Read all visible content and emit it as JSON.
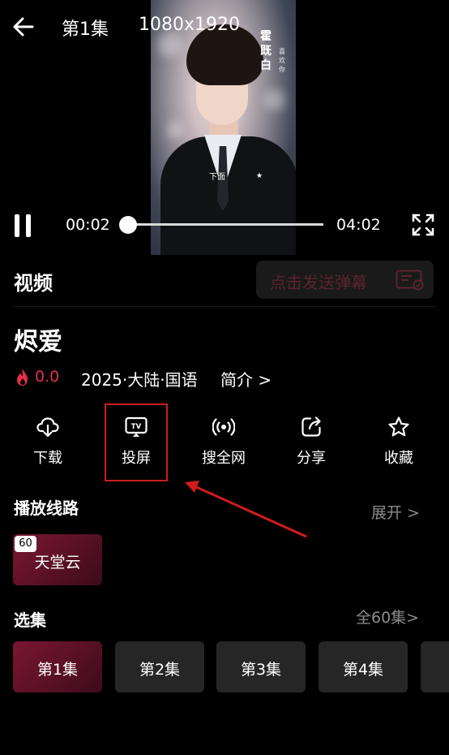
{
  "header": {
    "episode_title": "第1集",
    "resolution": "1080x1920"
  },
  "video": {
    "overlay_name": "霍既白",
    "overlay_tag": "喜欢你",
    "subtitle": "下面",
    "star": "★"
  },
  "player": {
    "current_time": "00:02",
    "total_time": "04:02",
    "progress": 0.01
  },
  "tabs": {
    "video_label": "视频",
    "danmaku_placeholder": "点击发送弹幕"
  },
  "info": {
    "title": "烬爱",
    "heat_score": "0.0",
    "meta": "2025·大陆·国语",
    "intro_link": "简介 >"
  },
  "actions": [
    {
      "label": "下载",
      "icon": "download-icon"
    },
    {
      "label": "投屏",
      "icon": "tv-cast-icon"
    },
    {
      "label": "搜全网",
      "icon": "broadcast-icon"
    },
    {
      "label": "分享",
      "icon": "share-icon"
    },
    {
      "label": "收藏",
      "icon": "star-icon"
    }
  ],
  "sources": {
    "title": "播放线路",
    "expand": "展开 >",
    "items": [
      {
        "name": "天堂云",
        "badge": "60"
      }
    ]
  },
  "episodes": {
    "title": "选集",
    "all_link": "全60集>",
    "items": [
      "第1集",
      "第2集",
      "第3集",
      "第4集"
    ]
  },
  "colors": {
    "accent": "#e4314a",
    "highlight_box": "#c81e1e",
    "active_card": "#6a1229"
  }
}
